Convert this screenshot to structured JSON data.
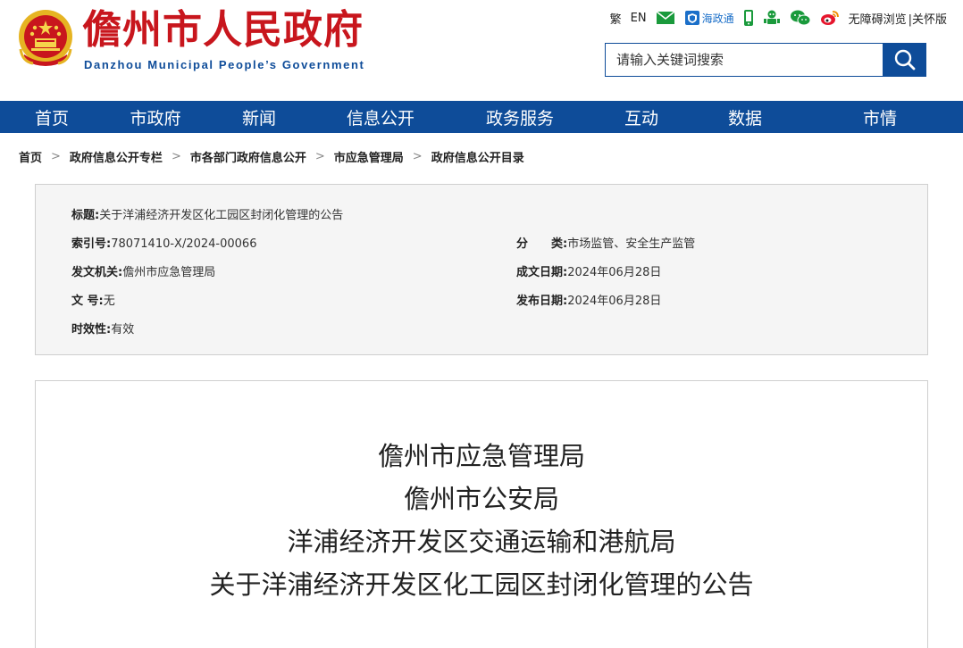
{
  "header": {
    "site_name": "儋州市人民政府",
    "site_name_en": "Danzhou Municipal People’s Government",
    "toolbar": {
      "traditional": "繁",
      "english": "EN",
      "haizhengtong": "海政通",
      "accessibility": "无障碍浏览",
      "elder": "|关怀版"
    },
    "search": {
      "placeholder": "请输入关键词搜索"
    }
  },
  "nav": {
    "items": [
      "首页",
      "市政府",
      "新闻",
      "信息公开",
      "政务服务",
      "互动",
      "数据",
      "市情"
    ]
  },
  "breadcrumb": {
    "items": [
      "首页",
      "政府信息公开专栏",
      "市各部门政府信息公开",
      "市应急管理局",
      "政府信息公开目录"
    ],
    "separator": ">"
  },
  "meta": {
    "title_label": "标题:",
    "title_value": "关于洋浦经济开发区化工园区封闭化管理的公告",
    "index_label": "索引号:",
    "index_value": "78071410-X/2024-00066",
    "category_label": "分　　类:",
    "category_value": "市场监管、安全生产监管",
    "issuer_label": "发文机关:",
    "issuer_value": "儋州市应急管理局",
    "written_label": "成文日期:",
    "written_value": "2024年06月28日",
    "docno_label": "文 号:",
    "docno_value": "无",
    "published_label": "发布日期:",
    "published_value": "2024年06月28日",
    "validity_label": "时效性:",
    "validity_value": "有效"
  },
  "article": {
    "titles": [
      "儋州市应急管理局",
      "儋州市公安局",
      "洋浦经济开发区交通运输和港航局",
      "关于洋浦经济开发区化工园区封闭化管理的公告"
    ]
  },
  "colors": {
    "brand_blue": "#0e4c99",
    "brand_red": "#c8161d"
  }
}
